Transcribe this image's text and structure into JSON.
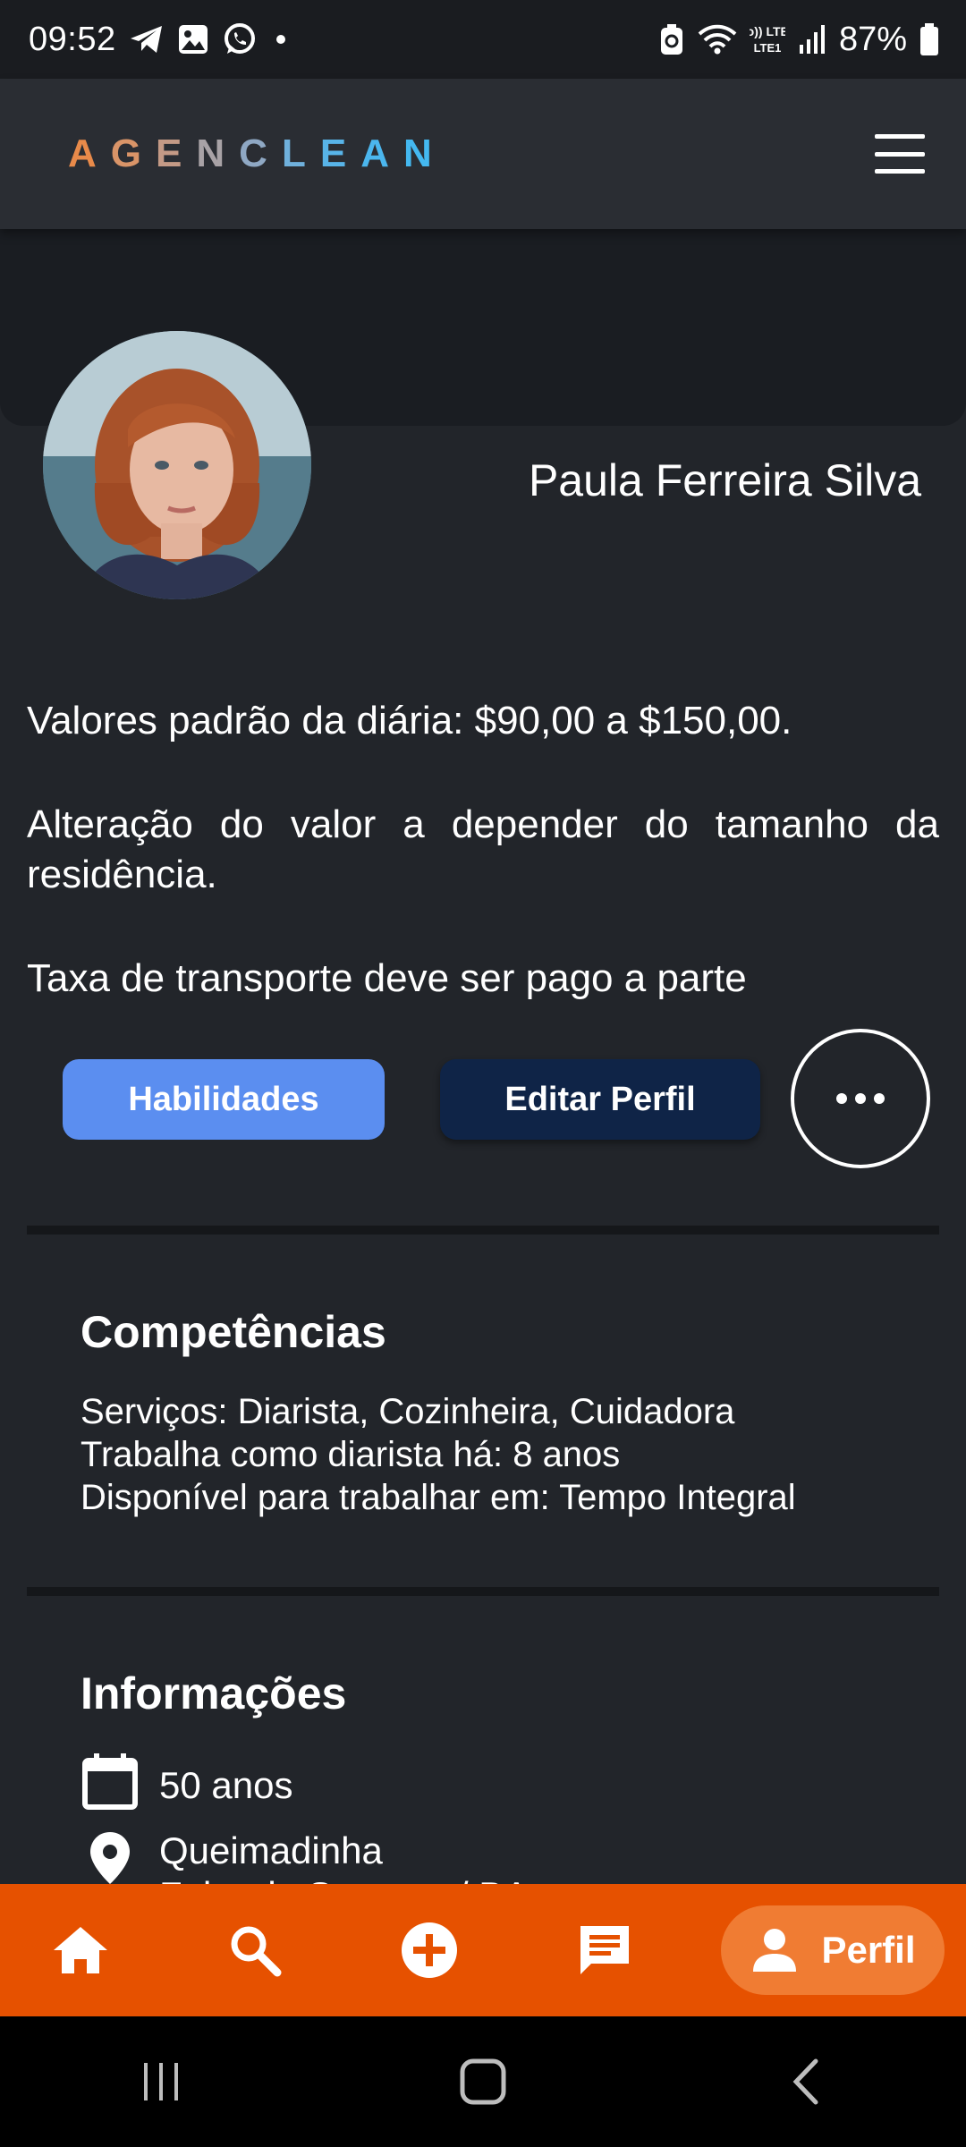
{
  "status_bar": {
    "time": "09:52",
    "battery": "87%",
    "network_label": "Vo)) LTE1"
  },
  "header": {
    "logo_text": "AGENCLEAN",
    "logo_colors": [
      "#e88a4a",
      "#44b8f0"
    ],
    "menu_icon": "hamburger-menu-icon"
  },
  "profile": {
    "name": "Paula Ferreira Silva",
    "avatar_icon": "user-photo"
  },
  "description": {
    "line1": "Valores padrão da diária: $90,00 a $150,00.",
    "line2": "Alteração do valor a depender do tamanho da residência.",
    "line3": "Taxa de transporte deve ser pago a parte"
  },
  "actions": {
    "skills_label": "Habilidades",
    "edit_label": "Editar Perfil",
    "more_icon": "more-horizontal-icon"
  },
  "competencias": {
    "title": "Competências",
    "items": [
      "Serviços: Diarista, Cozinheira, Cuidadora",
      "Trabalha como diarista há: 8 anos",
      "Disponível para trabalhar em: Tempo Integral"
    ]
  },
  "informacoes": {
    "title": "Informações",
    "age": "50 anos",
    "neighborhood": "Queimadinha",
    "city": "Feira de Santana / BA"
  },
  "bottom_nav": {
    "items": [
      {
        "icon": "home-icon"
      },
      {
        "icon": "search-icon"
      },
      {
        "icon": "add-circle-icon"
      },
      {
        "icon": "chat-icon"
      },
      {
        "icon": "person-icon",
        "label": "Perfil",
        "active": true
      }
    ],
    "background_color": "#e65100",
    "active_pill_color": "#f07c33"
  },
  "colors": {
    "background": "#22252a",
    "header": "#2a2d33",
    "primary_button": "#5b8ef0",
    "secondary_button": "#0f2447"
  }
}
